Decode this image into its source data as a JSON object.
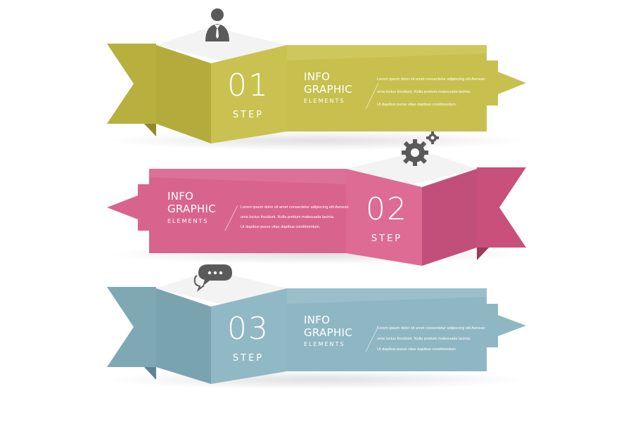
{
  "colors": {
    "step1": "#c7c04f",
    "step2": "#d8648e",
    "step3": "#8fb7c3"
  },
  "steps": [
    {
      "number": "01",
      "step_label": "STEP",
      "title_line1": "INFO",
      "title_line2": "GRAPHIC",
      "subtitle": "ELEMENTS",
      "body": [
        "Lorem ipsum dolor sit amet consectetur adipiscing elit Aenean",
        "uma luctus tincidunt. Nulla pretium malesuada lacinia.",
        "Ut dapibus purus vitae dapibus condimentum."
      ],
      "icon": "person-icon",
      "arrow": "right"
    },
    {
      "number": "02",
      "step_label": "STEP",
      "title_line1": "INFO",
      "title_line2": "GRAPHIC",
      "subtitle": "ELEMENTS",
      "body": [
        "Lorem ipsum dolor sit amet consectetur adipiscing elit Aenean",
        "uma luctus tincidunt. Nulla pretium malesuada lacinia.",
        "Ut dapibus purus vitae dapibus condimentum."
      ],
      "icon": "gears-icon",
      "arrow": "left"
    },
    {
      "number": "03",
      "step_label": "STEP",
      "title_line1": "INFO",
      "title_line2": "GRAPHIC",
      "subtitle": "ELEMENTS",
      "body": [
        "Lorem ipsum dolor sit amet consectetur adipiscing elit Aenean",
        "uma luctus tincidunt. Nulla pretium malesuada lacinia.",
        "Ut dapibus purus vitae dapibus condimentum."
      ],
      "icon": "chat-bubbles-icon",
      "arrow": "right"
    }
  ]
}
